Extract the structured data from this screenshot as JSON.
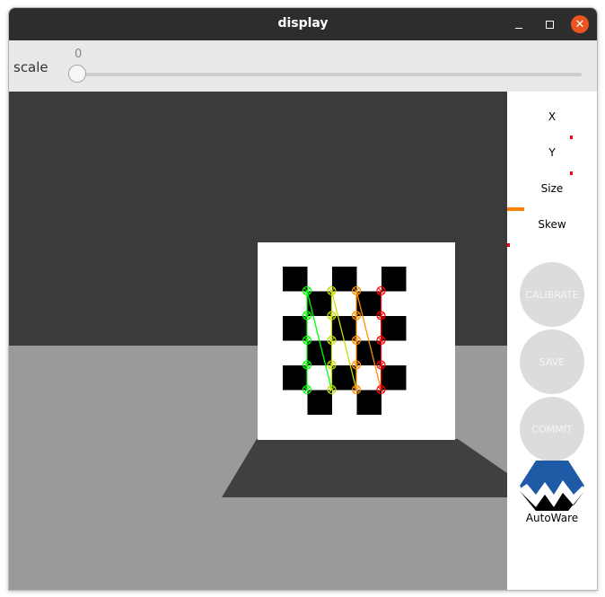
{
  "window": {
    "title": "display",
    "controls": [
      "minimize-icon",
      "maximize-icon",
      "close-icon"
    ]
  },
  "toolbar": {
    "scale_label": "scale",
    "scale_value": "0",
    "scale_fraction": 0
  },
  "sidebar": {
    "metrics": [
      {
        "label": "X",
        "fraction": 0.01,
        "color": "#ff0000"
      },
      {
        "label": "Y",
        "fraction": 0.01,
        "color": "#ff0000"
      },
      {
        "label": "Size",
        "fraction": 0.19,
        "color": "#ff7f00"
      },
      {
        "label": "Skew",
        "fraction": 0.01,
        "color": "#ff0000"
      }
    ],
    "buttons": {
      "calibrate": "CALIBRATE",
      "save": "SAVE",
      "commit": "COMMIT"
    },
    "logo_text": "AutoWare"
  },
  "scene": {
    "wall_color": "#3b3b3b",
    "floor_color": "#9a9a9a",
    "board_color": "#ffffff",
    "corner_colors": [
      "#00ff00",
      "#c8e000",
      "#ff9000",
      "#ff0000"
    ]
  }
}
